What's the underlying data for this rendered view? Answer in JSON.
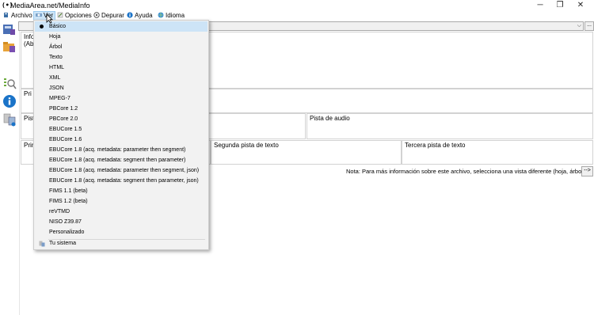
{
  "window": {
    "title": "MediaArea.net/MediaInfo",
    "icon_text": "(•)",
    "controls": {
      "minimize": "─",
      "maximize": "❐",
      "close": "✕"
    }
  },
  "menubar": [
    {
      "label": "Archivo",
      "icon": "archive-icon"
    },
    {
      "label": "Ver",
      "icon": "view-icon"
    },
    {
      "label": "Opciones",
      "icon": "options-icon"
    },
    {
      "label": "Depurar",
      "icon": "debug-icon"
    },
    {
      "label": "Ayuda",
      "icon": "help-icon"
    },
    {
      "label": "Idioma",
      "icon": "globe-icon"
    }
  ],
  "main": {
    "combo_arrow": "⌵",
    "combo_more": "...",
    "info_label": "Info",
    "info_sub": "(Abr",
    "general_label": "Pri",
    "video_label": "Pist",
    "audio_label": "Pista de audio",
    "text1_label": "Prin",
    "text2_label": "Segunda pista de texto",
    "text3_label": "Tercera pista de texto",
    "note": "Nota: Para más información sobre este archivo, selecciona una vista diferente (hoja, árbol...)",
    "note_button": "-->"
  },
  "view_menu": {
    "items": [
      "Básico",
      "Hoja",
      "Árbol",
      "Texto",
      "HTML",
      "XML",
      "JSON",
      "MPEG-7",
      "PBCore 1.2",
      "PBCore 2.0",
      "EBUCore 1.5",
      "EBUCore 1.6",
      "EBUCore 1.8 (acq. metadata: parameter then segment)",
      "EBUCore 1.8 (acq. metadata: segment then parameter)",
      "EBUCore 1.8 (acq. metadata: parameter then segment, json)",
      "EBUCore 1.8 (acq. metadata: segment then parameter, json)",
      "FIMS 1.1 (beta)",
      "FIMS 1.2 (beta)",
      "reVTMD",
      "NISO Z39.87",
      "Personalizado"
    ],
    "selected": "Básico",
    "system_item": "Tu sistema"
  },
  "colors": {
    "menu_highlight": "#cce4f7",
    "menu_bg": "#f2f2f2",
    "accent_blue": "#1a73c8"
  }
}
